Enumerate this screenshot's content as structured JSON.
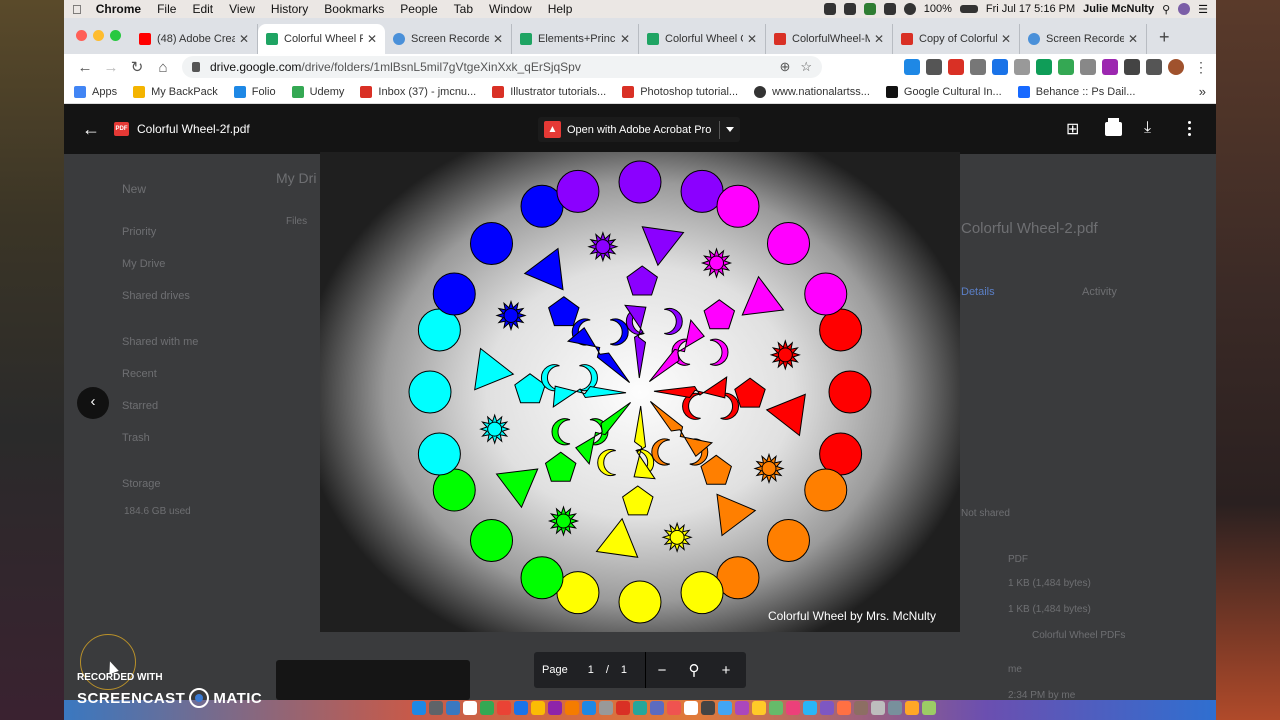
{
  "menubar": {
    "apple": "",
    "app_name": "Chrome",
    "items": [
      "File",
      "Edit",
      "View",
      "History",
      "Bookmarks",
      "People",
      "Tab",
      "Window",
      "Help"
    ],
    "battery": "100%",
    "datetime": "Fri Jul 17  5:16 PM",
    "user": "Julie McNulty"
  },
  "tabs": [
    {
      "label": "(48) Adobe Crea",
      "active": false,
      "favicon_color": "#ff0000"
    },
    {
      "label": "Colorful Wheel P",
      "active": true,
      "favicon_color": "#1fa463"
    },
    {
      "label": "Screen Recorder",
      "active": false,
      "favicon_color": "#4a90d9"
    },
    {
      "label": "Elements+Princi",
      "active": false,
      "favicon_color": "#1fa463"
    },
    {
      "label": "Colorful Wheel C",
      "active": false,
      "favicon_color": "#1fa463"
    },
    {
      "label": "ColorfulWheel-M",
      "active": false,
      "favicon_color": "#d93025"
    },
    {
      "label": "Copy of Colorful",
      "active": false,
      "favicon_color": "#d93025"
    },
    {
      "label": "Screen Recorder",
      "active": false,
      "favicon_color": "#4a90d9"
    }
  ],
  "toolbar": {
    "url_domain": "drive.google.com",
    "url_path": "/drive/folders/1mlBsnL5mil7gVtgeXinXxk_qErSjqSpv"
  },
  "bookmarks": [
    {
      "label": "Apps",
      "color": "#4285f4"
    },
    {
      "label": "My BackPack",
      "color": "#f4b400"
    },
    {
      "label": "Folio",
      "color": "#1e88e5"
    },
    {
      "label": "Udemy",
      "color": "#34a853"
    },
    {
      "label": "Inbox (37) - jmcnu...",
      "color": "#d93025"
    },
    {
      "label": "Illustrator tutorials...",
      "color": "#d93025"
    },
    {
      "label": "Photoshop tutorial...",
      "color": "#d93025"
    },
    {
      "label": "www.nationalartss...",
      "color": "#333333"
    },
    {
      "label": "Google Cultural In...",
      "color": "#111111"
    },
    {
      "label": "Behance :: Ps Dail...",
      "color": "#1769ff"
    }
  ],
  "drive_bg": {
    "new_label": "New",
    "nav": [
      "Priority",
      "My Drive",
      "Shared drives",
      "Shared with me",
      "Recent",
      "Starred",
      "Trash",
      "Storage"
    ],
    "storage": "184.6 GB used",
    "breadcrumb": "My Dri",
    "files_label": "Files",
    "details_title": "Colorful Wheel-2.pdf",
    "details_tabs": [
      "Details",
      "Activity"
    ],
    "sharing": "Not shared",
    "type": "PDF",
    "size": "1 KB (1,484 bytes)",
    "storage_used": "1 KB (1,484 bytes)",
    "location": "Colorful Wheel PDFs",
    "owner": "me",
    "modified": "2:34 PM by me"
  },
  "viewer": {
    "file_title": "Colorful Wheel-2f.pdf",
    "open_with": "Open with Adobe Acrobat Pro",
    "caption": "Colorful Wheel by Mrs. McNulty",
    "page_label": "Page",
    "page_current": "1",
    "page_sep": "/",
    "page_total": "1"
  },
  "watermark": {
    "recorded": "RECORDED WITH",
    "brand_left": "SCREENCAST",
    "brand_right": "MATIC"
  },
  "wheel_colors": [
    "#ff0000",
    "#ff7f00",
    "#ffff00",
    "#00ff00",
    "#00ffff",
    "#0000ff",
    "#8b00ff",
    "#ff00ff"
  ]
}
